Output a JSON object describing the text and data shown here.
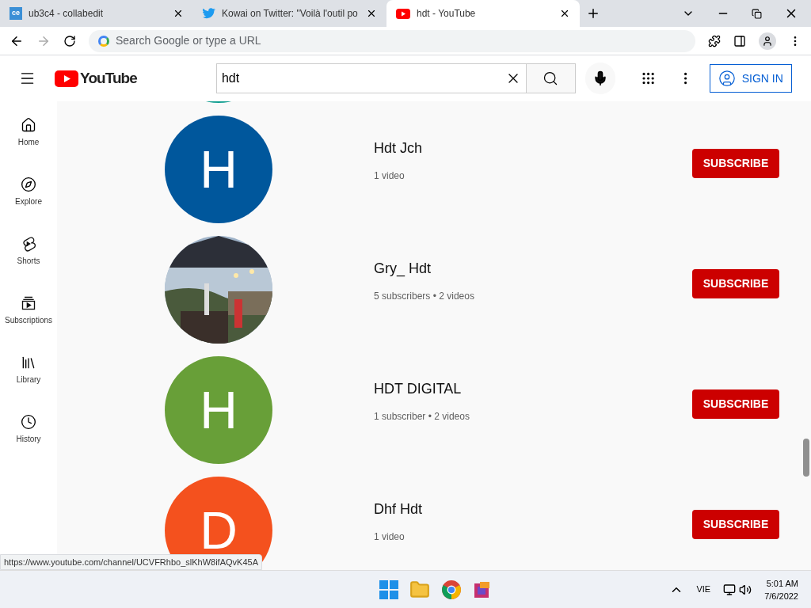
{
  "tabs": [
    {
      "title": "ub3c4 - collabedit",
      "icon": "ce",
      "kind": "ce",
      "selected": false
    },
    {
      "title": "Kowai on Twitter: \"Voilà l'outil po",
      "kind": "bird",
      "selected": false
    },
    {
      "title": "hdt - YouTube",
      "kind": "yt",
      "selected": true
    }
  ],
  "omnibox": {
    "placeholder": "Search Google or type a URL"
  },
  "youtube": {
    "logo": "YouTube",
    "search_value": "hdt",
    "sign_in": "SIGN IN"
  },
  "sidebar": {
    "items": [
      {
        "label": "Home",
        "kind": "home"
      },
      {
        "label": "Explore",
        "kind": "explore"
      },
      {
        "label": "Shorts",
        "kind": "shorts"
      },
      {
        "label": "Subscriptions",
        "kind": "subs"
      },
      {
        "label": "Library",
        "kind": "library"
      },
      {
        "label": "History",
        "kind": "history"
      }
    ]
  },
  "top_partial_avatar": {
    "color": "#0f9d8f"
  },
  "channels": [
    {
      "name": "Hdt Jch",
      "meta": [
        "1 video"
      ],
      "avatar": {
        "kind": "letter",
        "letter": "H",
        "color": "#00579c"
      },
      "button": "SUBSCRIBE"
    },
    {
      "name": "Gry_ Hdt",
      "meta": [
        "5 subscribers",
        "2 videos"
      ],
      "avatar": {
        "kind": "picture"
      },
      "button": "SUBSCRIBE"
    },
    {
      "name": "HDT DIGITAL",
      "meta": [
        "1 subscriber",
        "2 videos"
      ],
      "avatar": {
        "kind": "letter",
        "letter": "H",
        "color": "#689f38"
      },
      "button": "SUBSCRIBE"
    },
    {
      "name": "Dhf Hdt",
      "meta": [
        "1 video"
      ],
      "avatar": {
        "kind": "letter",
        "letter": "D",
        "color": "#f4511e"
      },
      "button": "SUBSCRIBE"
    }
  ],
  "meta_separator": "•",
  "status_url": "https://www.youtube.com/channel/UCVFRhbo_slKhW8ifAQvK45A",
  "taskbar": {
    "language": "VIE",
    "time": "5:01 AM",
    "date": "7/6/2022"
  }
}
